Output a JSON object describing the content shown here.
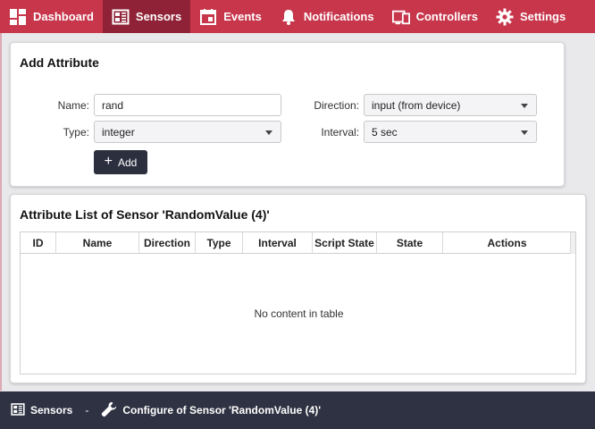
{
  "nav": {
    "items": [
      {
        "label": "Dashboard",
        "icon": "dashboard-icon",
        "active": false
      },
      {
        "label": "Sensors",
        "icon": "sensors-icon",
        "active": true
      },
      {
        "label": "Events",
        "icon": "calendar-icon",
        "active": false
      },
      {
        "label": "Notifications",
        "icon": "bell-icon",
        "active": false
      },
      {
        "label": "Controllers",
        "icon": "controllers-icon",
        "active": false
      },
      {
        "label": "Settings",
        "icon": "gear-icon",
        "active": false
      }
    ],
    "brand_color": "#c7364b",
    "active_color": "#8f2236"
  },
  "add_attribute": {
    "title": "Add Attribute",
    "name_label": "Name:",
    "name_value": "rand",
    "type_label": "Type:",
    "type_value": "integer",
    "direction_label": "Direction:",
    "direction_value": "input (from device)",
    "interval_label": "Interval:",
    "interval_value": "5 sec",
    "add_button": "Add"
  },
  "attribute_list": {
    "title": "Attribute List of Sensor 'RandomValue (4)'",
    "columns": [
      "ID",
      "Name",
      "Direction",
      "Type",
      "Interval",
      "Script State",
      "State",
      "Actions"
    ],
    "empty_message": "No content in table"
  },
  "breadcrumb": {
    "root": "Sensors",
    "separator": "-",
    "current": "Configure of Sensor 'RandomValue (4)'"
  }
}
